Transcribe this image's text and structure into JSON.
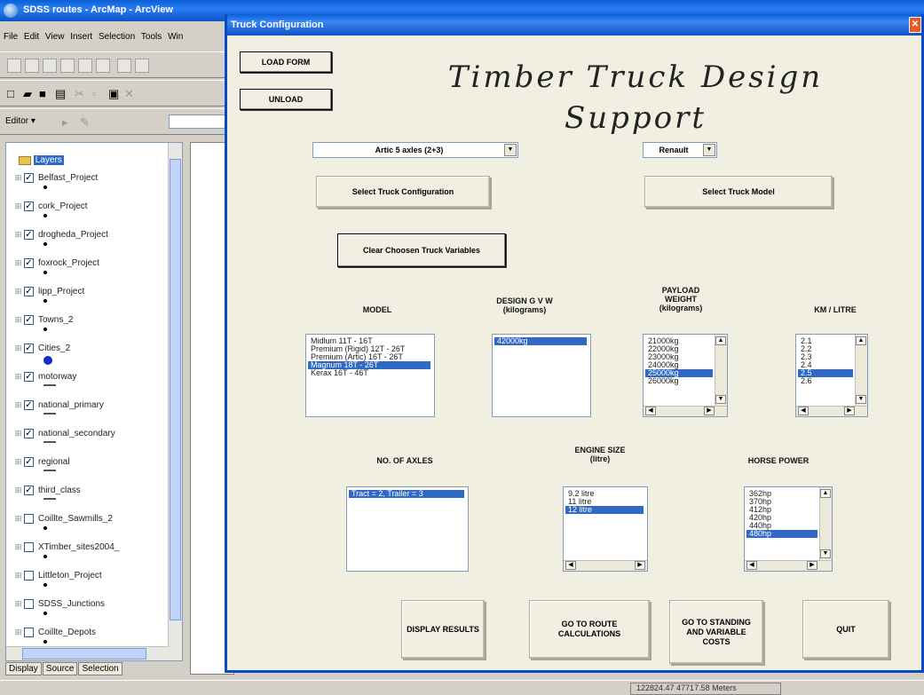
{
  "arcmap": {
    "title": "SDSS routes - ArcMap - ArcView",
    "menu": [
      "File",
      "Edit",
      "View",
      "Insert",
      "Selection",
      "Tools",
      "Win"
    ],
    "editor_label": "Editor ▾",
    "toc": {
      "root": "Layers",
      "layers": [
        {
          "name": "Belfast_Project",
          "checked": true,
          "symbol": "dot"
        },
        {
          "name": "cork_Project",
          "checked": true,
          "symbol": "dot"
        },
        {
          "name": "drogheda_Project",
          "checked": true,
          "symbol": "dot"
        },
        {
          "name": "foxrock_Project",
          "checked": true,
          "symbol": "dot"
        },
        {
          "name": "lipp_Project",
          "checked": true,
          "symbol": "dot"
        },
        {
          "name": "Towns_2",
          "checked": true,
          "symbol": "dot"
        },
        {
          "name": "Cities_2",
          "checked": true,
          "symbol": "bigdot"
        },
        {
          "name": "motorway",
          "checked": true,
          "symbol": "line"
        },
        {
          "name": "national_primary",
          "checked": true,
          "symbol": "line"
        },
        {
          "name": "national_secondary",
          "checked": true,
          "symbol": "line"
        },
        {
          "name": "regional",
          "checked": true,
          "symbol": "line"
        },
        {
          "name": "third_class",
          "checked": true,
          "symbol": "line"
        },
        {
          "name": "Coillte_Sawmills_2",
          "checked": false,
          "symbol": "dot"
        },
        {
          "name": "XTimber_sites2004_",
          "checked": false,
          "symbol": "dot"
        },
        {
          "name": "Littleton_Project",
          "checked": false,
          "symbol": "dot"
        },
        {
          "name": "SDSS_Junctions",
          "checked": false,
          "symbol": "dot"
        },
        {
          "name": "Coillte_Depots",
          "checked": false,
          "symbol": "dot"
        }
      ],
      "tabs": [
        "Display",
        "Source",
        "Selection"
      ]
    },
    "status_coords": "122824.47  47717.58 Meters"
  },
  "dialog": {
    "title": "Truck Configuration",
    "close_glyph": "✕",
    "main_title": "Timber Truck Design Support",
    "buttons": {
      "load_form": "LOAD FORM",
      "unload": "UNLOAD",
      "select_config": "Select Truck Configuration",
      "select_model": "Select Truck Model",
      "clear_variables": "Clear Choosen Truck Variables",
      "display_results": "DISPLAY RESULTS",
      "route_calc": "GO TO ROUTE CALCULATIONS",
      "standing_costs": "GO TO STANDING AND VARIABLE COSTS",
      "quit": "QUIT"
    },
    "config_combo": {
      "value": "Artic 5 axles (2+3)"
    },
    "make_combo": {
      "value": "Renault"
    },
    "headers": {
      "model": "MODEL",
      "gvw": "DESIGN G V W (kilograms)",
      "payload": "PAYLOAD WEIGHT (kilograms)",
      "km_litre": "KM / LITRE",
      "axles": "NO. OF AXLES",
      "engine": "ENGINE SIZE (litre)",
      "horse_power": "HORSE POWER"
    },
    "lists": {
      "model": {
        "items": [
          "Midlum 11T - 16T",
          "Premium (Rigid) 12T - 26T",
          "Premium (Artic) 16T - 26T",
          "Magnum 18T - 26T",
          "Kerax 16T - 46T"
        ],
        "selected": 3
      },
      "gvw": {
        "items": [
          "42000kg"
        ],
        "selected": 0
      },
      "payload": {
        "items": [
          "21000kg",
          "22000kg",
          "23000kg",
          "24000kg",
          "25000kg",
          "26000kg"
        ],
        "selected": 4
      },
      "km_litre": {
        "items": [
          "2.1",
          "2.2",
          "2.3",
          "2.4",
          "2.5",
          "2.6"
        ],
        "selected": 4
      },
      "axles": {
        "items": [
          "Tract = 2, Trailer = 3"
        ],
        "selected": 0
      },
      "engine": {
        "items": [
          "9.2 litre",
          "11 litre",
          "12 litre"
        ],
        "selected": 2
      },
      "horse_power": {
        "items": [
          "362hp",
          "370hp",
          "412hp",
          "420hp",
          "440hp",
          "480hp"
        ],
        "selected": 5
      }
    }
  }
}
